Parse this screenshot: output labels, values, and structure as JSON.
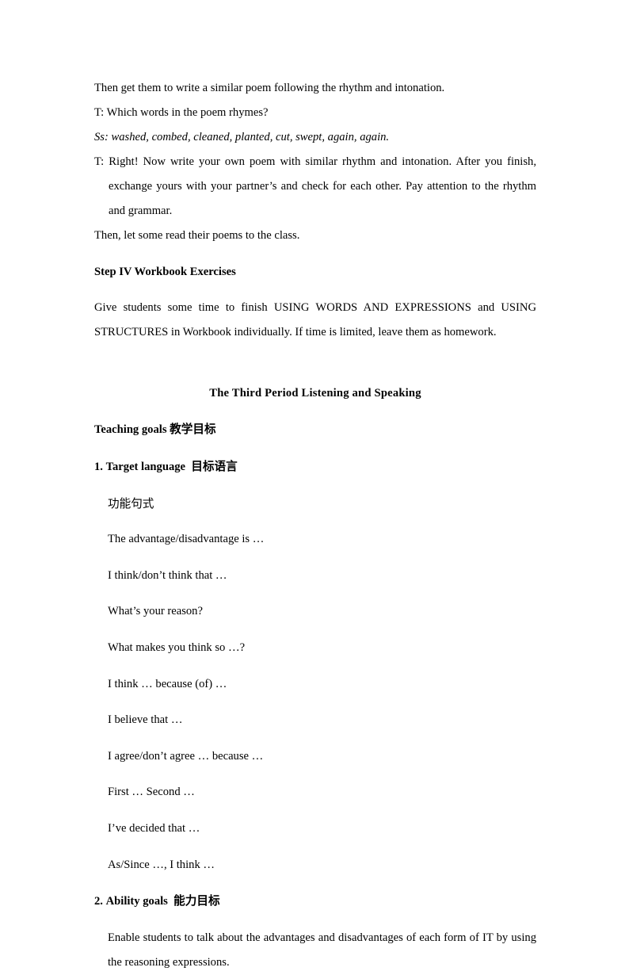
{
  "document": {
    "page_background": "#ffffff",
    "text_color": "#000000",
    "section_one": {
      "lines": [
        {
          "id": "l1",
          "text": "Then get them to write a similar poem following the rhythm and intonation.",
          "style": "normal"
        },
        {
          "id": "l2",
          "text": "T: Which words in the poem rhymes?",
          "style": "normal"
        },
        {
          "id": "l3",
          "text": "Ss: washed, combed, cleaned, planted, cut, swept, again, again.",
          "style": "italic"
        },
        {
          "id": "l4",
          "text": "T: Right! Now write your own poem with similar rhythm and intonation. After you finish, exchange yours with your partner’s and check for each other. Pay attention to the rhythm and grammar.",
          "style": "hanging"
        },
        {
          "id": "l5",
          "text": "Then, let some read their poems to the class.",
          "style": "normal"
        }
      ],
      "step_heading": "Step IV Workbook Exercises",
      "workbook_paragraph": "Give students some time to finish USING WORDS AND EXPRESSIONS and USING STRUCTURES in Workbook individually. If time is limited, leave them as homework."
    },
    "section_two": {
      "title": "The Third Period Listening and Speaking",
      "teaching_goals": {
        "label_en": "Teaching goals",
        "label_cn": "教学目标"
      },
      "target_language": {
        "number": "1.",
        "label_en": "Target language",
        "label_cn": "目标语言",
        "subheading_cn": "功能句式",
        "expressions": [
          "The advantage/disadvantage is …",
          "I think/don’t think that …",
          "What’s your reason?",
          "What makes you think so …?",
          "I think … because (of) …",
          "I believe that …",
          "I agree/don’t agree … because …",
          "First … Second …",
          "I’ve decided that …",
          "As/Since …, I think …"
        ]
      },
      "ability_goals": {
        "number": "2.",
        "label_en": "Ability goals",
        "label_cn": "能力目标",
        "body": "Enable students to talk about the advantages and disadvantages of each form of IT by using the reasoning expressions."
      }
    }
  }
}
